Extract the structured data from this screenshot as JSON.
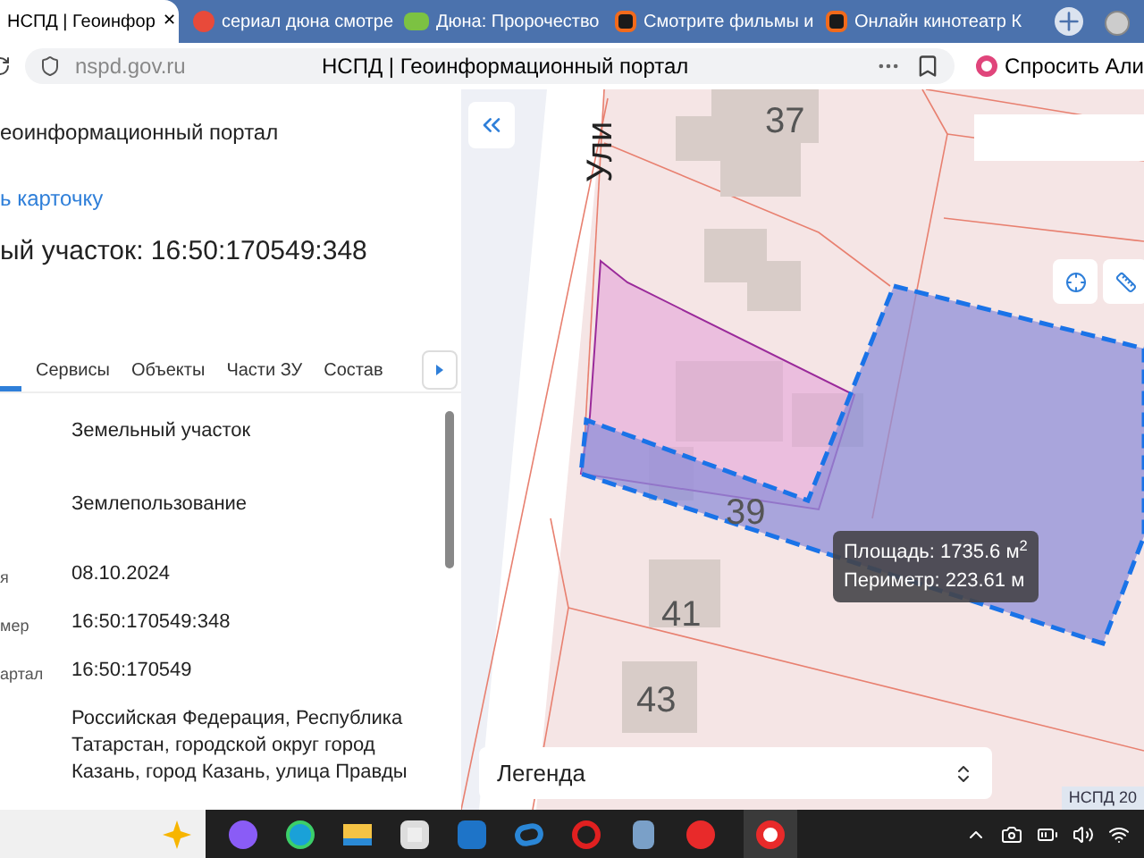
{
  "browser": {
    "tabs": [
      {
        "title": "НСПД | Геоинфор",
        "selected": true,
        "kind": "plain",
        "close": "✕"
      },
      {
        "title": "сериал дюна смотре",
        "selected": false,
        "kind": "search"
      },
      {
        "title": "Дюна: Пророчество",
        "selected": false,
        "kind": "video"
      },
      {
        "title": "Смотрите фильмы и",
        "selected": false,
        "kind": "cinema"
      },
      {
        "title": "Онлайн кинотеатр К",
        "selected": false,
        "kind": "cinema"
      }
    ],
    "address": {
      "url": "nspd.gov.ru",
      "page_title": "НСПД | Геоинформационный портал"
    },
    "assistant_button": "Спросить Али"
  },
  "panel": {
    "portal_title": "еоинформационный портал",
    "card_link": "ь карточку",
    "heading": "ый участок: 16:50:170549:348",
    "tabs": [
      {
        "selected": true
      },
      {
        "label": "Сервисы",
        "selected": false
      },
      {
        "label": "Объекты",
        "selected": false
      },
      {
        "label": "Части ЗУ",
        "selected": false
      },
      {
        "label": "Состав",
        "selected": false
      }
    ],
    "properties": [
      {
        "value": "Земельный участок"
      },
      {
        "value": "Землепользование"
      },
      {
        "label": "я",
        "value": "08.10.2024"
      },
      {
        "label": "мер",
        "value": "16:50:170549:348"
      },
      {
        "label": "артал",
        "value": "16:50:170549"
      },
      {
        "value": "Российская Федерация, Республика Татарстан, городской округ город Казань, город Казань, улица Правды"
      }
    ]
  },
  "map": {
    "street_label": "Ули",
    "house_numbers": [
      "37",
      "39",
      "41",
      "43"
    ],
    "measure_tooltip": {
      "area": "Площадь: 1735.6 м$^{2}$",
      "perimeter": "Периметр: 223.61 м"
    },
    "legend": "Легенда",
    "attribution": "НСПД 20"
  }
}
